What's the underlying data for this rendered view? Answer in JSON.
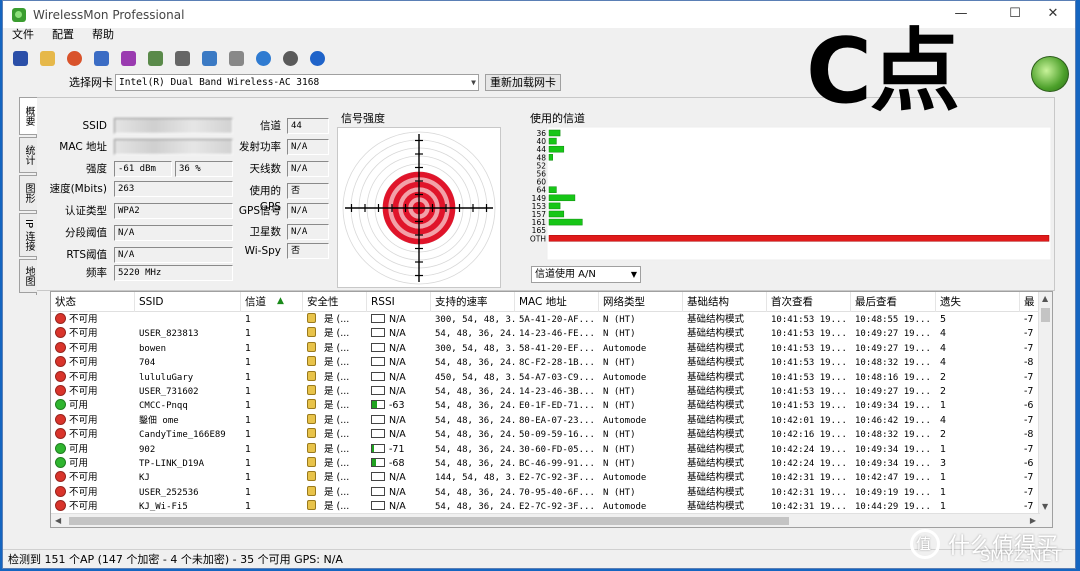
{
  "window": {
    "title": "WirelessMon Professional",
    "controls": {
      "minimize": "—",
      "maximize": "☐",
      "close": "✕"
    }
  },
  "menu": [
    "文件",
    "配置",
    "帮助"
  ],
  "toolbar_icons": [
    "save-icon",
    "open-folder-icon",
    "record-icon",
    "network-icon",
    "connect-icon",
    "export-icon",
    "print-icon",
    "report-icon",
    "clipboard-icon",
    "globe-icon",
    "wifi-scan-icon",
    "help-icon"
  ],
  "overlay_text": "C点",
  "adapter": {
    "label": "选择网卡",
    "value": "Intel(R) Dual Band Wireless-AC 3168",
    "reload_label": "重新加载网卡"
  },
  "vertical_tabs": [
    "概要",
    "统计",
    "图形",
    "IP 连接",
    "地图"
  ],
  "fields_left": [
    {
      "label": "SSID",
      "value": "",
      "blurred": true
    },
    {
      "label": "MAC 地址",
      "value": "",
      "blurred": true
    },
    {
      "label": "强度",
      "value": "-61 dBm",
      "extra": "36 %"
    },
    {
      "label": "速度(Mbits)",
      "value": "263"
    },
    {
      "label": "认证类型",
      "value": "WPA2"
    },
    {
      "label": "分段阈值",
      "value": "N/A"
    },
    {
      "label": "RTS阈值",
      "value": "N/A"
    },
    {
      "label": "频率",
      "value": "5220 MHz"
    }
  ],
  "fields_right": [
    {
      "label": "信道",
      "value": "44"
    },
    {
      "label": "发射功率",
      "value": "N/A"
    },
    {
      "label": "天线数",
      "value": "N/A"
    },
    {
      "label": "使用的GPS",
      "value": "否"
    },
    {
      "label": "GPS信号",
      "value": "N/A"
    },
    {
      "label": "卫星数",
      "value": "N/A"
    },
    {
      "label": "Wi-Spy",
      "value": "否"
    }
  ],
  "signal": {
    "title": "信号强度",
    "strength_percent": 36
  },
  "channels": {
    "title": "使用的信道",
    "select_value": "信道使用 A/N",
    "colors": {
      "bar": "#17c617",
      "oth": "#e01a1a"
    }
  },
  "chart_data": {
    "type": "bar",
    "categories": [
      "36",
      "40",
      "44",
      "48",
      "52",
      "56",
      "60",
      "64",
      "149",
      "153",
      "157",
      "161",
      "165",
      "OTH"
    ],
    "values": [
      3,
      2,
      4,
      1,
      0,
      0,
      0,
      2,
      7,
      3,
      4,
      9,
      0,
      135
    ],
    "xlim": [
      0,
      135
    ]
  },
  "table": {
    "columns": [
      "状态",
      "SSID",
      "信道",
      "安全性",
      "RSSI",
      "支持的速率",
      "MAC 地址",
      "网络类型",
      "基础结构",
      "首次查看",
      "最后查看",
      "遗失",
      "最"
    ],
    "sort_indicator": "▲",
    "rows": [
      {
        "status": "不可用",
        "ok": false,
        "ssid": "",
        "ch": "1",
        "sec": "是 (...",
        "rssi": "N/A",
        "fill": 0,
        "rates": "300, 54, 48, 3...",
        "mac": "5A-41-20-AF...",
        "net": "N (HT)",
        "infra": "基础结构模式",
        "first": "10:41:53 19...",
        "last": "10:48:55 19...",
        "lost": "5",
        "max": "-7"
      },
      {
        "status": "不可用",
        "ok": false,
        "ssid": "USER_823813",
        "ch": "1",
        "sec": "是 (...",
        "rssi": "N/A",
        "fill": 0,
        "rates": "54, 48, 36, 24...",
        "mac": "14-23-46-FE...",
        "net": "N (HT)",
        "infra": "基础结构模式",
        "first": "10:41:53 19...",
        "last": "10:49:27 19...",
        "lost": "4",
        "max": "-7"
      },
      {
        "status": "不可用",
        "ok": false,
        "ssid": "bowen",
        "ch": "1",
        "sec": "是 (...",
        "rssi": "N/A",
        "fill": 0,
        "rates": "300, 54, 48, 3...",
        "mac": "58-41-20-EF...",
        "net": "Automode",
        "infra": "基础结构模式",
        "first": "10:41:53 19...",
        "last": "10:49:27 19...",
        "lost": "4",
        "max": "-7"
      },
      {
        "status": "不可用",
        "ok": false,
        "ssid": "704",
        "ch": "1",
        "sec": "是 (...",
        "rssi": "N/A",
        "fill": 0,
        "rates": "54, 48, 36, 24...",
        "mac": "8C-F2-28-1B...",
        "net": "N (HT)",
        "infra": "基础结构模式",
        "first": "10:41:53 19...",
        "last": "10:48:32 19...",
        "lost": "4",
        "max": "-8"
      },
      {
        "status": "不可用",
        "ok": false,
        "ssid": "lululuGary",
        "ch": "1",
        "sec": "是 (...",
        "rssi": "N/A",
        "fill": 0,
        "rates": "450, 54, 48, 3...",
        "mac": "54-A7-03-C9...",
        "net": "Automode",
        "infra": "基础结构模式",
        "first": "10:41:53 19...",
        "last": "10:48:16 19...",
        "lost": "2",
        "max": "-7"
      },
      {
        "status": "不可用",
        "ok": false,
        "ssid": "USER_731602",
        "ch": "1",
        "sec": "是 (...",
        "rssi": "N/A",
        "fill": 0,
        "rates": "54, 48, 36, 24...",
        "mac": "14-23-46-3B...",
        "net": "N (HT)",
        "infra": "基础结构模式",
        "first": "10:41:53 19...",
        "last": "10:49:27 19...",
        "lost": "2",
        "max": "-7"
      },
      {
        "status": "可用",
        "ok": true,
        "ssid": "CMCC-Pnqq",
        "ch": "1",
        "sec": "是 (...",
        "rssi": "-63",
        "fill": 0.4,
        "rates": "54, 48, 36, 24...",
        "mac": "E0-1F-ED-71...",
        "net": "N (HT)",
        "infra": "基础结构模式",
        "first": "10:41:53 19...",
        "last": "10:49:34 19...",
        "lost": "1",
        "max": "-6"
      },
      {
        "status": "不可用",
        "ok": false,
        "ssid": "鑿佃 ome",
        "ch": "1",
        "sec": "是 (...",
        "rssi": "N/A",
        "fill": 0,
        "rates": "54, 48, 36, 24...",
        "mac": "80-EA-07-23...",
        "net": "Automode",
        "infra": "基础结构模式",
        "first": "10:42:01 19...",
        "last": "10:46:42 19...",
        "lost": "4",
        "max": "-7"
      },
      {
        "status": "不可用",
        "ok": false,
        "ssid": "CandyTime_166E89",
        "ch": "1",
        "sec": "是 (...",
        "rssi": "N/A",
        "fill": 0,
        "rates": "54, 48, 36, 24...",
        "mac": "50-09-59-16...",
        "net": "N (HT)",
        "infra": "基础结构模式",
        "first": "10:42:16 19...",
        "last": "10:48:32 19...",
        "lost": "2",
        "max": "-8"
      },
      {
        "status": "可用",
        "ok": true,
        "ssid": "902",
        "ch": "1",
        "sec": "是 (...",
        "rssi": "-71",
        "fill": 0.2,
        "rates": "54, 48, 36, 24...",
        "mac": "30-60-FD-05...",
        "net": "N (HT)",
        "infra": "基础结构模式",
        "first": "10:42:24 19...",
        "last": "10:49:34 19...",
        "lost": "1",
        "max": "-7"
      },
      {
        "status": "可用",
        "ok": true,
        "ssid": "TP-LINK_D19A",
        "ch": "1",
        "sec": "是 (...",
        "rssi": "-68",
        "fill": 0.3,
        "rates": "54, 48, 36, 24...",
        "mac": "BC-46-99-91...",
        "net": "N (HT)",
        "infra": "基础结构模式",
        "first": "10:42:24 19...",
        "last": "10:49:34 19...",
        "lost": "3",
        "max": "-6"
      },
      {
        "status": "不可用",
        "ok": false,
        "ssid": "KJ",
        "ch": "1",
        "sec": "是 (...",
        "rssi": "N/A",
        "fill": 0,
        "rates": "144, 54, 48, 3...",
        "mac": "E2-7C-92-3F...",
        "net": "Automode",
        "infra": "基础结构模式",
        "first": "10:42:31 19...",
        "last": "10:42:47 19...",
        "lost": "1",
        "max": "-7"
      },
      {
        "status": "不可用",
        "ok": false,
        "ssid": "USER_252536",
        "ch": "1",
        "sec": "是 (...",
        "rssi": "N/A",
        "fill": 0,
        "rates": "54, 48, 36, 24...",
        "mac": "70-95-40-6F...",
        "net": "N (HT)",
        "infra": "基础结构模式",
        "first": "10:42:31 19...",
        "last": "10:49:19 19...",
        "lost": "1",
        "max": "-7"
      },
      {
        "status": "不可用",
        "ok": false,
        "ssid": "KJ_Wi-Fi5",
        "ch": "1",
        "sec": "是 (...",
        "rssi": "N/A",
        "fill": 0,
        "rates": "54, 48, 36, 24...",
        "mac": "E2-7C-92-3F...",
        "net": "Automode",
        "infra": "基础结构模式",
        "first": "10:42:31 19...",
        "last": "10:44:29 19...",
        "lost": "1",
        "max": "-7"
      }
    ]
  },
  "status_bar": "检测到 151 个AP (147 个加密 - 4 个未加密) - 35 个可用  GPS: N/A",
  "watermark": {
    "main": "什么值得买",
    "sub": "SMYZ.NET"
  },
  "colors": {
    "available": "#2fb52f",
    "unavailable": "#d9342b",
    "signal": "#e0142a"
  }
}
